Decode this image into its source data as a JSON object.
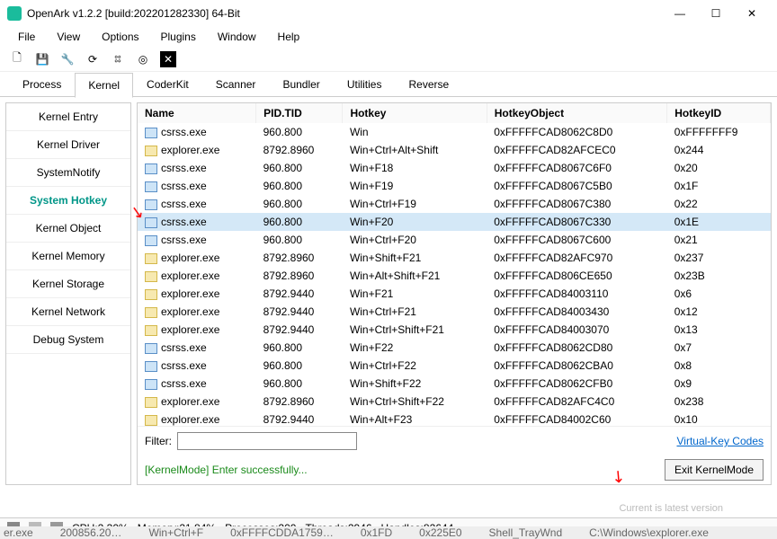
{
  "window": {
    "title": "OpenArk v1.2.2  [build:202201282330]  64-Bit",
    "min": "—",
    "max": "☐",
    "close": "✕"
  },
  "menu": [
    "File",
    "View",
    "Options",
    "Plugins",
    "Window",
    "Help"
  ],
  "tabs": [
    "Process",
    "Kernel",
    "CoderKit",
    "Scanner",
    "Bundler",
    "Utilities",
    "Reverse"
  ],
  "active_tab": 1,
  "sidebar": [
    "Kernel Entry",
    "Kernel Driver",
    "SystemNotify",
    "System Hotkey",
    "Kernel Object",
    "Kernel Memory",
    "Kernel Storage",
    "Kernel Network",
    "Debug System"
  ],
  "sidebar_active": 3,
  "columns": [
    "Name",
    "PID.TID",
    "Hotkey",
    "HotkeyObject",
    "HotkeyID"
  ],
  "selected_row": 5,
  "rows": [
    {
      "ic": "exe",
      "name": "csrss.exe",
      "pid": "960.800",
      "hk": "Win",
      "obj": "0xFFFFFCAD8062C8D0",
      "id": "0xFFFFFFF9"
    },
    {
      "ic": "fld",
      "name": "explorer.exe",
      "pid": "8792.8960",
      "hk": "Win+Ctrl+Alt+Shift",
      "obj": "0xFFFFFCAD82AFCEC0",
      "id": "0x244"
    },
    {
      "ic": "exe",
      "name": "csrss.exe",
      "pid": "960.800",
      "hk": "Win+F18",
      "obj": "0xFFFFFCAD8067C6F0",
      "id": "0x20"
    },
    {
      "ic": "exe",
      "name": "csrss.exe",
      "pid": "960.800",
      "hk": "Win+F19",
      "obj": "0xFFFFFCAD8067C5B0",
      "id": "0x1F"
    },
    {
      "ic": "exe",
      "name": "csrss.exe",
      "pid": "960.800",
      "hk": "Win+Ctrl+F19",
      "obj": "0xFFFFFCAD8067C380",
      "id": "0x22"
    },
    {
      "ic": "exe",
      "name": "csrss.exe",
      "pid": "960.800",
      "hk": "Win+F20",
      "obj": "0xFFFFFCAD8067C330",
      "id": "0x1E"
    },
    {
      "ic": "exe",
      "name": "csrss.exe",
      "pid": "960.800",
      "hk": "Win+Ctrl+F20",
      "obj": "0xFFFFFCAD8067C600",
      "id": "0x21"
    },
    {
      "ic": "fld",
      "name": "explorer.exe",
      "pid": "8792.8960",
      "hk": "Win+Shift+F21",
      "obj": "0xFFFFFCAD82AFC970",
      "id": "0x237"
    },
    {
      "ic": "fld",
      "name": "explorer.exe",
      "pid": "8792.8960",
      "hk": "Win+Alt+Shift+F21",
      "obj": "0xFFFFFCAD806CE650",
      "id": "0x23B"
    },
    {
      "ic": "fld",
      "name": "explorer.exe",
      "pid": "8792.9440",
      "hk": "Win+F21",
      "obj": "0xFFFFFCAD84003110",
      "id": "0x6"
    },
    {
      "ic": "fld",
      "name": "explorer.exe",
      "pid": "8792.9440",
      "hk": "Win+Ctrl+F21",
      "obj": "0xFFFFFCAD84003430",
      "id": "0x12"
    },
    {
      "ic": "fld",
      "name": "explorer.exe",
      "pid": "8792.9440",
      "hk": "Win+Ctrl+Shift+F21",
      "obj": "0xFFFFFCAD84003070",
      "id": "0x13"
    },
    {
      "ic": "exe",
      "name": "csrss.exe",
      "pid": "960.800",
      "hk": "Win+F22",
      "obj": "0xFFFFFCAD8062CD80",
      "id": "0x7"
    },
    {
      "ic": "exe",
      "name": "csrss.exe",
      "pid": "960.800",
      "hk": "Win+Ctrl+F22",
      "obj": "0xFFFFFCAD8062CBA0",
      "id": "0x8"
    },
    {
      "ic": "exe",
      "name": "csrss.exe",
      "pid": "960.800",
      "hk": "Win+Shift+F22",
      "obj": "0xFFFFFCAD8062CFB0",
      "id": "0x9"
    },
    {
      "ic": "fld",
      "name": "explorer.exe",
      "pid": "8792.8960",
      "hk": "Win+Ctrl+Shift+F22",
      "obj": "0xFFFFFCAD82AFC4C0",
      "id": "0x238"
    },
    {
      "ic": "fld",
      "name": "explorer.exe",
      "pid": "8792.9440",
      "hk": "Win+Alt+F23",
      "obj": "0xFFFFFCAD84002C60",
      "id": "0x10"
    }
  ],
  "filter": {
    "label": "Filter:",
    "value": ""
  },
  "vklink": "Virtual-Key Codes",
  "status_msg": "[KernelMode] Enter successfully...",
  "exit_btn": "Exit KernelMode",
  "bottom": {
    "cpu": "CPU:2.30%",
    "mem": "Memory:21.84%",
    "proc": "Processes:200",
    "thr": "Threads:2946",
    "hnd": "Handles:82644",
    "version": "Current is latest version"
  },
  "scrap": {
    "a": "er.exe",
    "b": "200856.20…",
    "c": "Win+Ctrl+F",
    "d": "0xFFFFCDDA1759…",
    "e": "0x1FD",
    "f": "0x225E0",
    "g": "Shell_TrayWnd",
    "h": "C:\\Windows\\explorer.exe"
  }
}
